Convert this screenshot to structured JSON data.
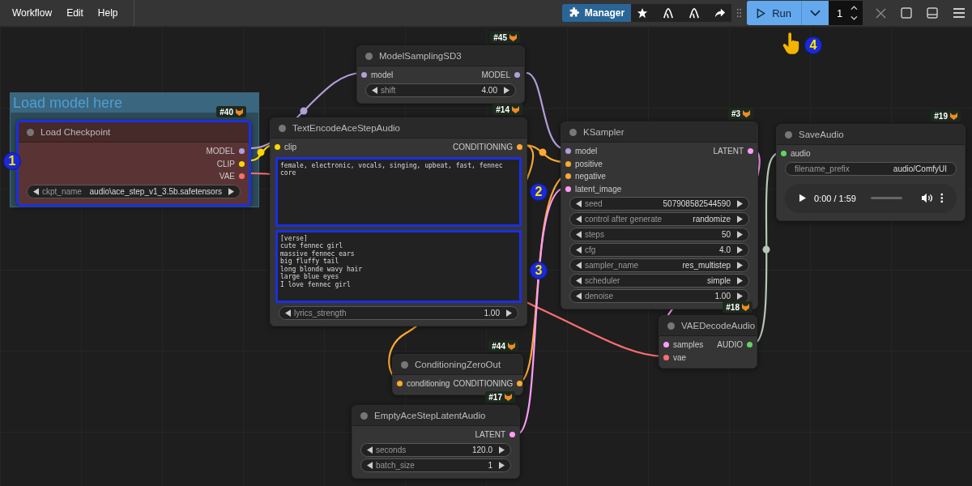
{
  "topbar": {
    "menu": [
      "Workflow",
      "Edit",
      "Help"
    ],
    "manager_label": "Manager",
    "run_label": "Run",
    "batch_count": "1"
  },
  "group": {
    "title": "Load model here"
  },
  "nodes": [
    {
      "id": "#45",
      "title": "ModelSamplingSD3",
      "color": "#353535",
      "highlighted": false,
      "inputs": [
        {
          "name": "model",
          "color": "#b39ddb"
        }
      ],
      "outputs": [
        {
          "name": "MODEL",
          "color": "#b39ddb"
        }
      ],
      "widgets": [
        {
          "kind": "stepper",
          "name": "shift",
          "value": "4.00"
        }
      ]
    },
    {
      "id": "#40",
      "title": "Load Checkpoint",
      "color": "#5a3434",
      "highlighted": true,
      "outputs": [
        {
          "name": "MODEL",
          "color": "#b39ddb"
        },
        {
          "name": "CLIP",
          "color": "#ffd500"
        },
        {
          "name": "VAE",
          "color": "#ff6e6e"
        }
      ],
      "widgets": [
        {
          "kind": "stepper",
          "name": "ckpt_name",
          "value": "audio\\ace_step_v1_3.5b.safetensors"
        }
      ]
    },
    {
      "id": "#14",
      "title": "TextEncodeAceStepAudio",
      "color": "#353535",
      "highlighted": false,
      "inputs": [
        {
          "name": "clip",
          "color": "#ffd500"
        }
      ],
      "outputs": [
        {
          "name": "CONDITIONING",
          "color": "#ffa931"
        }
      ],
      "textareas": [
        {
          "text": "female, electronic, vocals, singing, upbeat, fast, fennec core",
          "highlighted": true
        },
        {
          "text": "[verse]\ncute fennec girl\nmassive fennec ears\nbig fluffy tail\nlong blonde wavy hair\nlarge blue eyes\nI love fennec girl",
          "highlighted": true
        }
      ],
      "widgets": [
        {
          "kind": "stepper",
          "name": "lyrics_strength",
          "value": "1.00"
        }
      ]
    },
    {
      "id": "#3",
      "title": "KSampler",
      "color": "#353535",
      "highlighted": false,
      "inputs": [
        {
          "name": "model",
          "color": "#b39ddb"
        },
        {
          "name": "positive",
          "color": "#ffa931"
        },
        {
          "name": "negative",
          "color": "#ffa931"
        },
        {
          "name": "latent_image",
          "color": "#ff9cf9"
        }
      ],
      "outputs": [
        {
          "name": "LATENT",
          "color": "#ff9cf9"
        }
      ],
      "widgets": [
        {
          "kind": "stepper",
          "name": "seed",
          "value": "507908582544590"
        },
        {
          "kind": "stepper",
          "name": "control after generate",
          "value": "randomize"
        },
        {
          "kind": "stepper",
          "name": "steps",
          "value": "50"
        },
        {
          "kind": "stepper",
          "name": "cfg",
          "value": "4.0"
        },
        {
          "kind": "stepper",
          "name": "sampler_name",
          "value": "res_multistep"
        },
        {
          "kind": "stepper",
          "name": "scheduler",
          "value": "simple"
        },
        {
          "kind": "stepper",
          "name": "denoise",
          "value": "1.00"
        }
      ]
    },
    {
      "id": "#19",
      "title": "SaveAudio",
      "color": "#353535",
      "highlighted": false,
      "inputs": [
        {
          "name": "audio",
          "color": "#64d264"
        }
      ],
      "widgets": [
        {
          "kind": "text",
          "name": "filename_prefix",
          "value": "audio/ComfyUI"
        }
      ],
      "audio_player": {
        "time": "0:00 / 1:59",
        "level": 0
      }
    },
    {
      "id": "#18",
      "title": "VAEDecodeAudio",
      "color": "#353535",
      "highlighted": false,
      "inputs": [
        {
          "name": "samples",
          "color": "#ff9cf9"
        },
        {
          "name": "vae",
          "color": "#ff6e6e"
        }
      ],
      "outputs": [
        {
          "name": "AUDIO",
          "color": "#64d264"
        }
      ]
    },
    {
      "id": "#44",
      "title": "ConditioningZeroOut",
      "color": "#353535",
      "highlighted": false,
      "inputs": [
        {
          "name": "conditioning",
          "color": "#ffa931"
        }
      ],
      "outputs": [
        {
          "name": "CONDITIONING",
          "color": "#ffa931"
        }
      ]
    },
    {
      "id": "#17",
      "title": "EmptyAceStepLatentAudio",
      "color": "#353535",
      "highlighted": false,
      "outputs": [
        {
          "name": "LATENT",
          "color": "#ff9cf9"
        }
      ],
      "widgets": [
        {
          "kind": "stepper",
          "name": "seconds",
          "value": "120.0"
        },
        {
          "kind": "stepper",
          "name": "batch_size",
          "value": "1"
        }
      ]
    }
  ],
  "callouts": [
    "1",
    "2",
    "3",
    "4"
  ]
}
